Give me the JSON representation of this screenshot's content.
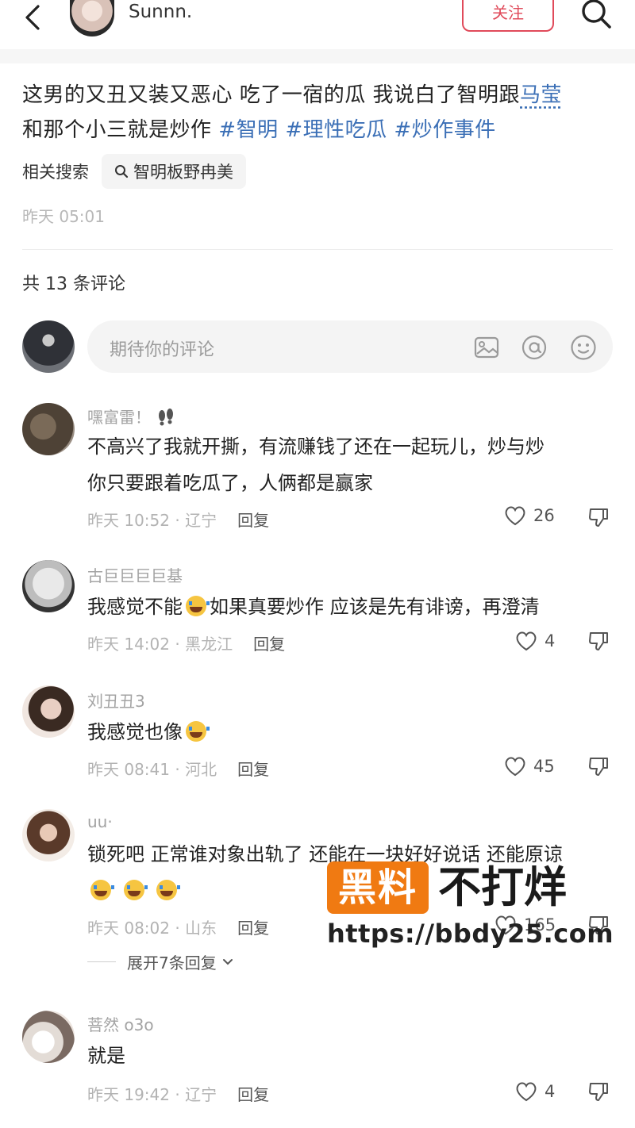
{
  "header": {
    "author_name": "Sunnn.",
    "follow_label": "关注"
  },
  "post": {
    "text_main": "这男的又丑又装又恶心 吃了一宿的瓜 我说白了智明跟",
    "link_text": "马莹",
    "text_cont": "和那个小三就是炒作",
    "tags": [
      "#智明",
      "#理性吃瓜",
      "#炒作事件"
    ],
    "related_label": "相关搜索",
    "related_query": "智明板野冉美",
    "time": "昨天 05:01"
  },
  "comments_header": {
    "count_text": "共 13 条评论"
  },
  "comment_input": {
    "placeholder": "期待你的评论"
  },
  "comments": [
    {
      "name": "嘿富雷！",
      "text_line1": "不高兴了我就开撕，有流赚钱了还在一起玩儿，炒与炒",
      "text_line2": "你只要跟着吃瓜了，人俩都是赢家",
      "meta": "昨天 10:52 · 辽宁",
      "reply": "回复",
      "likes": "26"
    },
    {
      "name": "古巨巨巨巨基",
      "text_a": "我感觉不能",
      "text_b": "如果真要炒作 应该是先有诽谤，再澄清",
      "meta": "昨天 14:02 · 黑龙江",
      "reply": "回复",
      "likes": "4"
    },
    {
      "name": "刘丑丑3",
      "text": "我感觉也像",
      "meta": "昨天 08:41 · 河北",
      "reply": "回复",
      "likes": "45"
    },
    {
      "name": "uu·",
      "text": "锁死吧 正常谁对象出轨了 还能在一块好好说话 还能原谅",
      "meta": "昨天 08:02 · 山东",
      "reply": "回复",
      "likes": "165"
    },
    {
      "name": "菩然 o3o",
      "text": "就是",
      "meta": "昨天 19:42 · 辽宁",
      "reply": "回复",
      "likes": "4"
    }
  ],
  "expand_replies": "展开7条回复",
  "watermark": {
    "badge": "黑料",
    "title": "不打烊",
    "url": "https://bbdy25.com"
  },
  "colors": {
    "accent_red": "#e04a5a",
    "link_blue": "#3b6fb6",
    "watermark_orange": "#f07a12"
  }
}
